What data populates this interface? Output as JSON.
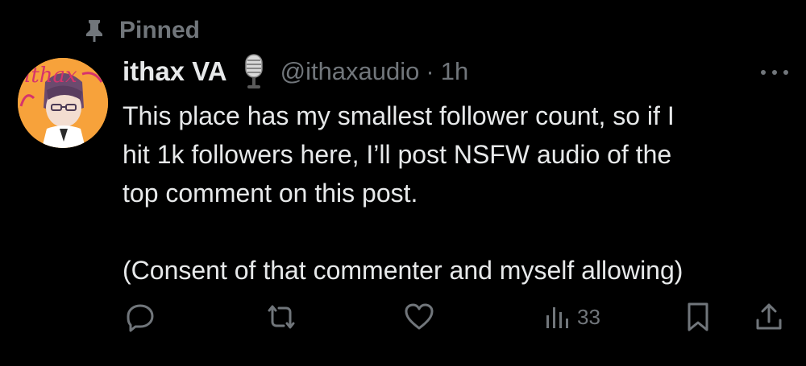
{
  "pinned": {
    "label": "Pinned",
    "icon": "pin-icon"
  },
  "author": {
    "display_name": "ithax VA",
    "badge_emoji": "microphone-emoji",
    "handle": "@ithaxaudio",
    "separator": "·",
    "time": "1h",
    "avatar_text": "ithax"
  },
  "tweet": {
    "lines": [
      "This place has my smallest follower count, so if I",
      "hit 1k followers here, I’ll post NSFW audio of the",
      "top comment on this post."
    ],
    "second_paragraph": "(Consent of that commenter and myself allowing)"
  },
  "actions": {
    "reply_icon": "reply-icon",
    "repost_icon": "repost-icon",
    "like_icon": "heart-icon",
    "views_icon": "views-chart-icon",
    "views_count": "33",
    "bookmark_icon": "bookmark-icon",
    "share_icon": "share-icon"
  },
  "colors": {
    "background": "#000000",
    "text_primary": "#e7e9ea",
    "text_secondary": "#71767b",
    "avatar_bg": "#f7a23b"
  }
}
